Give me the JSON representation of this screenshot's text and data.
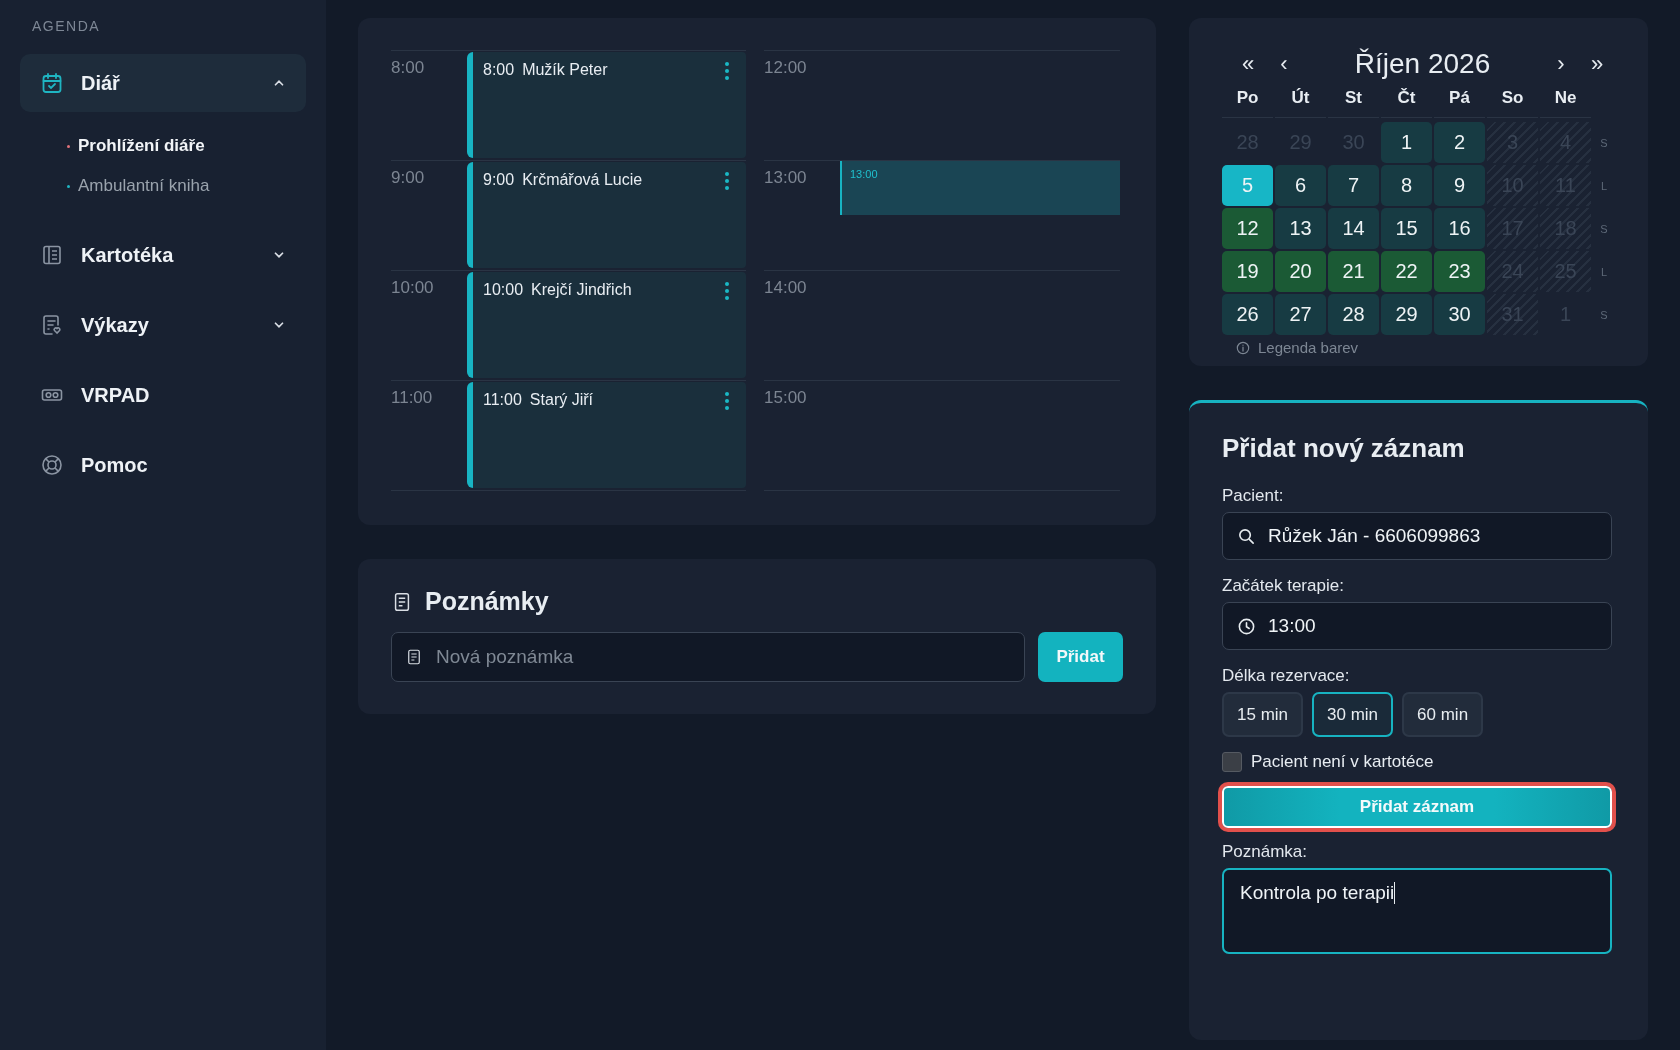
{
  "sidebar": {
    "section_label": "AGENDA",
    "items": [
      {
        "label": "Diář",
        "selected": true,
        "expanded": true,
        "children": [
          {
            "label": "Prohlížení diáře",
            "selected": true
          },
          {
            "label": "Ambulantní kniha",
            "selected": false
          }
        ]
      },
      {
        "label": "Kartotéka",
        "selected": false,
        "expanded": false
      },
      {
        "label": "Výkazy",
        "selected": false,
        "expanded": false
      },
      {
        "label": "VRPAD",
        "selected": false
      },
      {
        "label": "Pomoc",
        "selected": false
      }
    ]
  },
  "schedule": {
    "columns": [
      {
        "rows": [
          {
            "time": "8:00",
            "event": {
              "time": "8:00",
              "name": "Mužík Peter"
            }
          },
          {
            "time": "9:00",
            "event": {
              "time": "9:00",
              "name": "Krčmářová Lucie"
            }
          },
          {
            "time": "10:00",
            "event": {
              "time": "10:00",
              "name": "Krejčí Jindřich"
            }
          },
          {
            "time": "11:00",
            "event": {
              "time": "11:00",
              "name": "Starý Jiří"
            }
          }
        ]
      },
      {
        "rows": [
          {
            "time": "12:00"
          },
          {
            "time": "13:00",
            "selection": "13:00"
          },
          {
            "time": "14:00"
          },
          {
            "time": "15:00"
          }
        ]
      }
    ]
  },
  "notes": {
    "title": "Poznámky",
    "input": {
      "placeholder": "Nová poznámka"
    },
    "button": "Přidat"
  },
  "calendar": {
    "prev_year": "«",
    "prev_month": "‹",
    "title": "Říjen 2026",
    "next_month": "›",
    "next_year": "»",
    "weekdays": [
      "Po",
      "Út",
      "St",
      "Čt",
      "Pá",
      "So",
      "Ne"
    ],
    "weeks": [
      {
        "parity": "S",
        "days": [
          {
            "day": "28",
            "kind": "other"
          },
          {
            "day": "29",
            "kind": "other"
          },
          {
            "day": "30",
            "kind": "other"
          },
          {
            "day": "1",
            "kind": "free"
          },
          {
            "day": "2",
            "kind": "free"
          },
          {
            "day": "3",
            "kind": "weekend"
          },
          {
            "day": "4",
            "kind": "weekend"
          }
        ]
      },
      {
        "parity": "L",
        "days": [
          {
            "day": "5",
            "kind": "today"
          },
          {
            "day": "6",
            "kind": "free"
          },
          {
            "day": "7",
            "kind": "free"
          },
          {
            "day": "8",
            "kind": "free"
          },
          {
            "day": "9",
            "kind": "free"
          },
          {
            "day": "10",
            "kind": "weekend"
          },
          {
            "day": "11",
            "kind": "weekend"
          }
        ]
      },
      {
        "parity": "S",
        "days": [
          {
            "day": "12",
            "kind": "busy"
          },
          {
            "day": "13",
            "kind": "free"
          },
          {
            "day": "14",
            "kind": "free"
          },
          {
            "day": "15",
            "kind": "free"
          },
          {
            "day": "16",
            "kind": "free"
          },
          {
            "day": "17",
            "kind": "weekend"
          },
          {
            "day": "18",
            "kind": "weekend"
          }
        ]
      },
      {
        "parity": "L",
        "days": [
          {
            "day": "19",
            "kind": "busy"
          },
          {
            "day": "20",
            "kind": "busy"
          },
          {
            "day": "21",
            "kind": "busy"
          },
          {
            "day": "22",
            "kind": "busy"
          },
          {
            "day": "23",
            "kind": "busy"
          },
          {
            "day": "24",
            "kind": "weekend"
          },
          {
            "day": "25",
            "kind": "weekend"
          }
        ]
      },
      {
        "parity": "S",
        "days": [
          {
            "day": "26",
            "kind": "free"
          },
          {
            "day": "27",
            "kind": "free"
          },
          {
            "day": "28",
            "kind": "free"
          },
          {
            "day": "29",
            "kind": "free"
          },
          {
            "day": "30",
            "kind": "free"
          },
          {
            "day": "31",
            "kind": "weekend"
          },
          {
            "day": "1",
            "kind": "other"
          }
        ]
      }
    ],
    "legend": "Legenda barev"
  },
  "form": {
    "title": "Přidat nový záznam",
    "patient_label": "Pacient:",
    "patient_value": "Růžek Ján - 6606099863",
    "start_label": "Začátek terapie:",
    "start_value": "13:00",
    "duration_label": "Délka rezervace:",
    "durations": [
      {
        "label": "15 min",
        "selected": false
      },
      {
        "label": "30 min",
        "selected": true
      },
      {
        "label": "60 min",
        "selected": false
      }
    ],
    "not_in_registry": {
      "label": "Pacient není v kartotéce",
      "checked": false
    },
    "submit": {
      "label": "Přidat záznam",
      "highlighted": true
    },
    "note_label": "Poznámka:",
    "note_value": "Kontrola po terapii"
  }
}
